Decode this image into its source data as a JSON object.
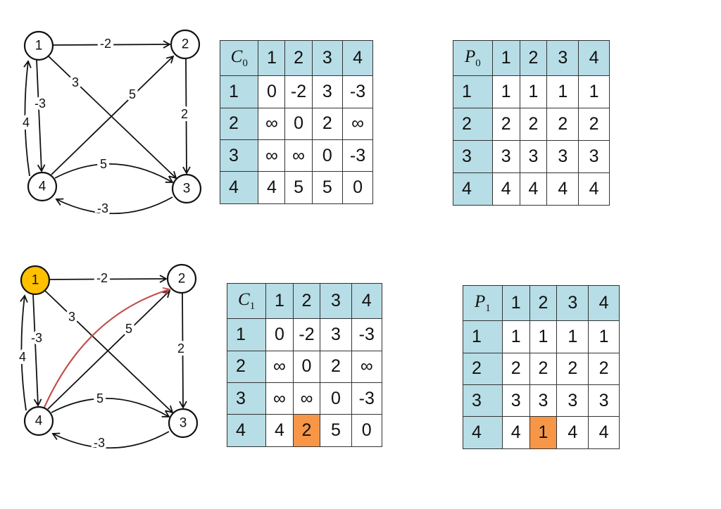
{
  "colors": {
    "header": "#b7dde6",
    "highlight_cell": "#f79646",
    "highlight_node": "#ffc000",
    "highlight_edge": "#c0504d"
  },
  "graphs": [
    {
      "nodes": [
        "1",
        "2",
        "3",
        "4"
      ],
      "highlight_node": null,
      "edges": [
        {
          "from": "1",
          "to": "2",
          "w": "-2"
        },
        {
          "from": "1",
          "to": "3",
          "w": "3"
        },
        {
          "from": "1",
          "to": "4",
          "w": "-3"
        },
        {
          "from": "2",
          "to": "3",
          "w": "2"
        },
        {
          "from": "4",
          "to": "1",
          "w": "4"
        },
        {
          "from": "4",
          "to": "2",
          "w": "5"
        },
        {
          "from": "4",
          "to": "3",
          "w": "5"
        },
        {
          "from": "3",
          "to": "4",
          "w": "-3"
        }
      ]
    },
    {
      "nodes": [
        "1",
        "2",
        "3",
        "4"
      ],
      "highlight_node": "1",
      "highlight_edge": {
        "from": "4",
        "to": "2"
      },
      "edges": [
        {
          "from": "1",
          "to": "2",
          "w": "-2"
        },
        {
          "from": "1",
          "to": "3",
          "w": "3"
        },
        {
          "from": "1",
          "to": "4",
          "w": "-3"
        },
        {
          "from": "2",
          "to": "3",
          "w": "2"
        },
        {
          "from": "4",
          "to": "1",
          "w": "4"
        },
        {
          "from": "4",
          "to": "2",
          "w": "5"
        },
        {
          "from": "4",
          "to": "3",
          "w": "5"
        },
        {
          "from": "3",
          "to": "4",
          "w": "-3"
        }
      ]
    }
  ],
  "tables": {
    "C0": {
      "name": "C",
      "sub": "0",
      "cols": [
        "1",
        "2",
        "3",
        "4"
      ],
      "rows": [
        [
          "1",
          "0",
          "-2",
          "3",
          "-3"
        ],
        [
          "2",
          "∞",
          "0",
          "2",
          "∞"
        ],
        [
          "3",
          "∞",
          "∞",
          "0",
          "-3"
        ],
        [
          "4",
          "4",
          "5",
          "5",
          "0"
        ]
      ]
    },
    "P0": {
      "name": "P",
      "sub": "0",
      "cols": [
        "1",
        "2",
        "3",
        "4"
      ],
      "rows": [
        [
          "1",
          "1",
          "1",
          "1",
          "1"
        ],
        [
          "2",
          "2",
          "2",
          "2",
          "2"
        ],
        [
          "3",
          "3",
          "3",
          "3",
          "3"
        ],
        [
          "4",
          "4",
          "4",
          "4",
          "4"
        ]
      ]
    },
    "C1": {
      "name": "C",
      "sub": "1",
      "cols": [
        "1",
        "2",
        "3",
        "4"
      ],
      "rows": [
        [
          "1",
          "0",
          "-2",
          "3",
          "-3"
        ],
        [
          "2",
          "∞",
          "0",
          "2",
          "∞"
        ],
        [
          "3",
          "∞",
          "∞",
          "0",
          "-3"
        ],
        [
          "4",
          "4",
          "2",
          "5",
          "0"
        ]
      ],
      "highlight": {
        "row": 4,
        "col": 2
      }
    },
    "P1": {
      "name": "P",
      "sub": "1",
      "cols": [
        "1",
        "2",
        "3",
        "4"
      ],
      "rows": [
        [
          "1",
          "1",
          "1",
          "1",
          "1"
        ],
        [
          "2",
          "2",
          "2",
          "2",
          "2"
        ],
        [
          "3",
          "3",
          "3",
          "3",
          "3"
        ],
        [
          "4",
          "4",
          "1",
          "4",
          "4"
        ]
      ],
      "highlight": {
        "row": 4,
        "col": 2
      }
    }
  }
}
